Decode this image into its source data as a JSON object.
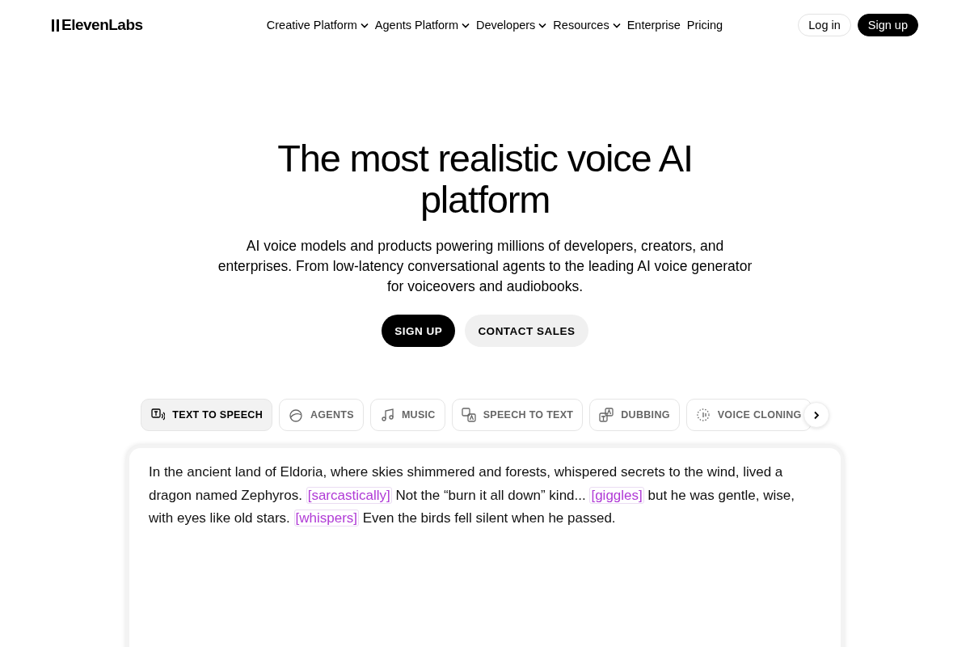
{
  "header": {
    "logo": "ElevenLabs",
    "nav": [
      {
        "label": "Creative Platform",
        "dropdown": true
      },
      {
        "label": "Agents Platform",
        "dropdown": true
      },
      {
        "label": "Developers",
        "dropdown": true
      },
      {
        "label": "Resources",
        "dropdown": true
      },
      {
        "label": "Enterprise",
        "dropdown": false
      },
      {
        "label": "Pricing",
        "dropdown": false
      }
    ],
    "login": "Log in",
    "signup": "Sign up"
  },
  "hero": {
    "title": "The most realistic voice AI platform",
    "subtitle": "AI voice models and products powering millions of developers, creators, and enterprises. From low-latency conversational agents to the leading AI voice generator for voiceovers and audiobooks.",
    "primary": "SIGN UP",
    "secondary": "CONTACT SALES"
  },
  "tabs": [
    {
      "label": "TEXT TO SPEECH",
      "selected": true
    },
    {
      "label": "AGENTS",
      "selected": false
    },
    {
      "label": "MUSIC",
      "selected": false
    },
    {
      "label": "SPEECH TO TEXT",
      "selected": false
    },
    {
      "label": "DUBBING",
      "selected": false
    },
    {
      "label": "VOICE CLONING",
      "selected": false
    }
  ],
  "editor": {
    "segments": [
      {
        "kind": "text",
        "text": "In the ancient land of Eldoria, where skies shimmered and forests, whispered secrets to the wind, lived a dragon named Zephyros. "
      },
      {
        "kind": "tag",
        "text": "[sarcastically]"
      },
      {
        "kind": "text",
        "text": " Not the “burn it all down” kind... "
      },
      {
        "kind": "tag",
        "text": "[giggles]"
      },
      {
        "kind": "text",
        "text": " but he was gentle, wise, with eyes like old stars. "
      },
      {
        "kind": "tag",
        "text": "[whispers]"
      },
      {
        "kind": "text",
        "text": " Even the birds fell silent when he passed."
      }
    ]
  }
}
